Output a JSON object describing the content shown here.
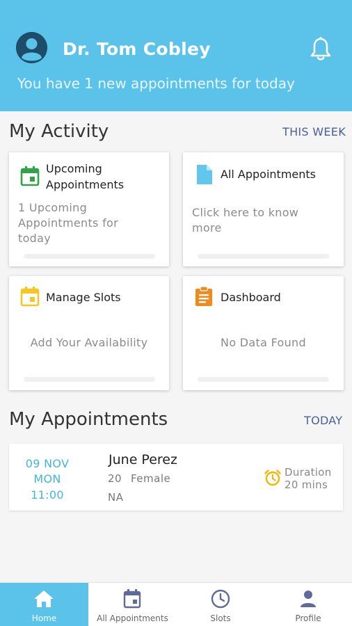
{
  "header": {
    "doctor_name": "Dr. Tom Cobley",
    "greeting": "You have 1 new appointments for today",
    "bg_color": "#5bc3e9"
  },
  "activity": {
    "title": "My Activity",
    "period": "THIS WEEK",
    "cards": [
      {
        "icon": "calendar-icon",
        "title_line1": "Upcoming",
        "title_line2": "Appointments",
        "sub_lines": [
          "1 Upcoming",
          "Appointments for",
          "today"
        ],
        "icon_color": "#2fa24a"
      },
      {
        "icon": "document-icon",
        "title_line1": "All Appointments",
        "sub_lines": [
          "Click here to know",
          "more"
        ],
        "icon_color": "#62c6ee"
      },
      {
        "icon": "calendar-icon",
        "title_line1": "Manage Slots",
        "sub_lines": [
          "Add Your Availability"
        ],
        "icon_color": "#f6c623"
      },
      {
        "icon": "clipboard-icon",
        "title_line1": "Dashboard",
        "sub_lines": [
          "No Data Found"
        ],
        "icon_color": "#f08a1c"
      }
    ]
  },
  "appointments": {
    "title": "My Appointments",
    "period": "TODAY",
    "items": [
      {
        "date": "09 NOV",
        "day": "MON",
        "time": "11:00",
        "patient_name": "June Perez",
        "age": "20",
        "gender": "Female",
        "note": "NA",
        "duration_label": "Duration",
        "duration_value": "20 mins"
      }
    ]
  },
  "nav": {
    "items": [
      {
        "label": "Home",
        "icon": "home-icon",
        "active": true
      },
      {
        "label": "All Appointments",
        "icon": "calendar-icon",
        "active": false
      },
      {
        "label": "Slots",
        "icon": "clock-icon",
        "active": false
      },
      {
        "label": "Profile",
        "icon": "person-icon",
        "active": false
      }
    ]
  }
}
